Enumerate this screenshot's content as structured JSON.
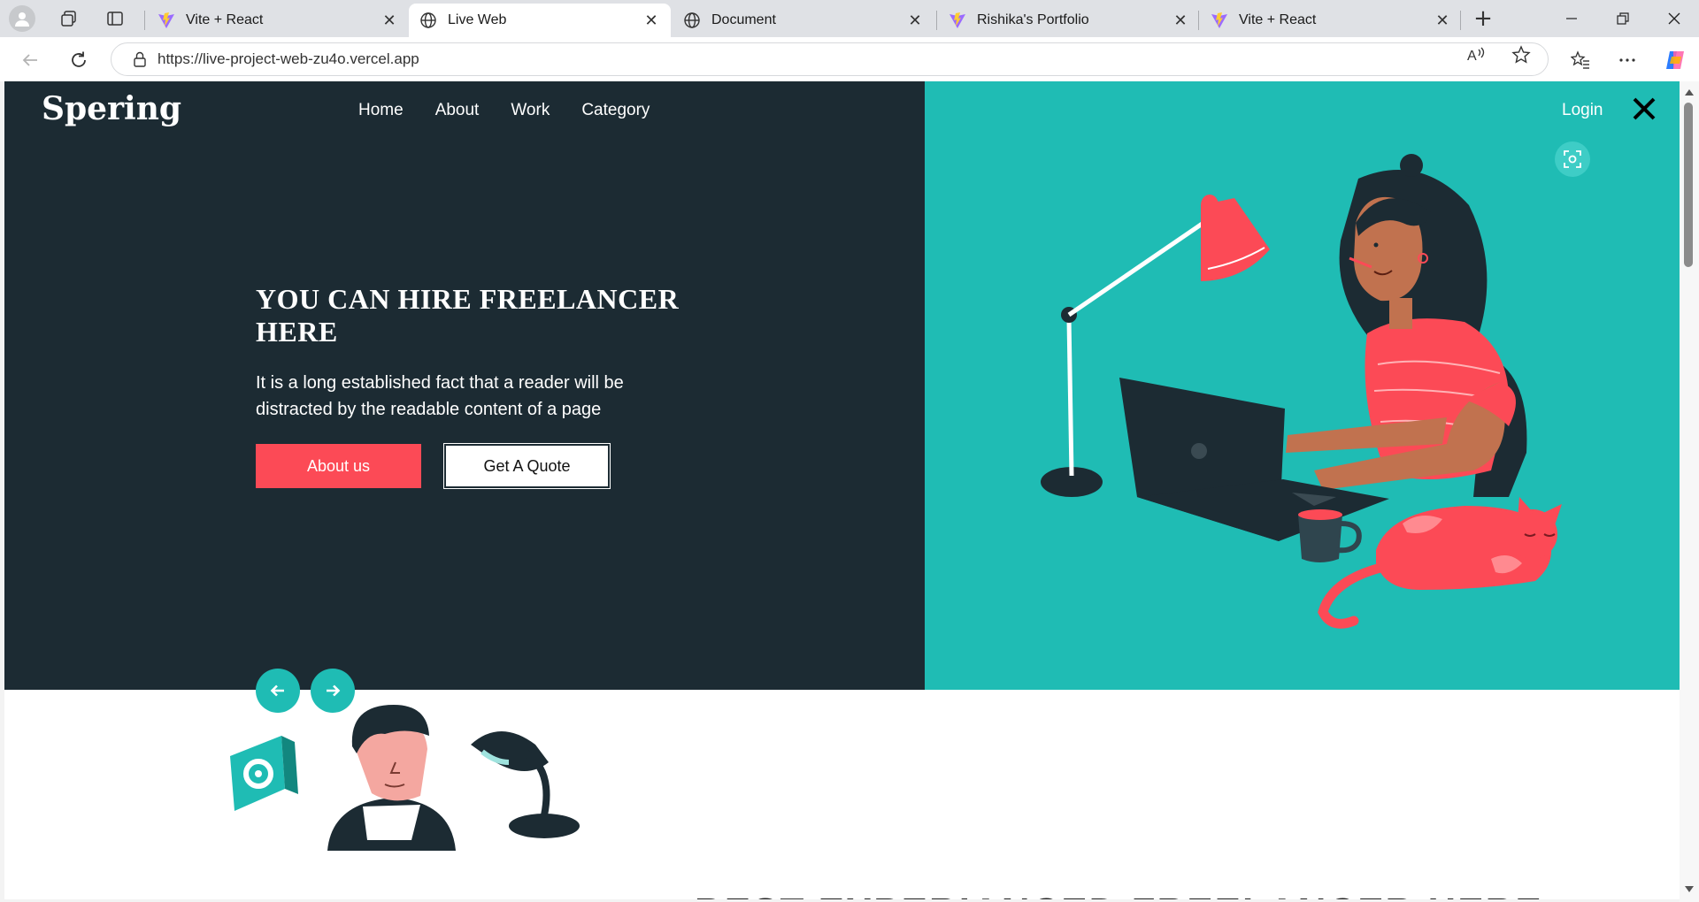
{
  "browser": {
    "tabs": [
      {
        "title": "Vite + React",
        "icon": "vite-icon",
        "active": false
      },
      {
        "title": "Live Web",
        "icon": "globe-icon",
        "active": true
      },
      {
        "title": "Document",
        "icon": "globe-icon",
        "active": false
      },
      {
        "title": "Rishika's Portfolio",
        "icon": "vite-icon",
        "active": false
      },
      {
        "title": "Vite + React",
        "icon": "vite-icon",
        "active": false
      }
    ],
    "tab_close_glyph": "✕",
    "newtab_glyph": "+",
    "url": "https://live-project-web-zu4o.vercel.app"
  },
  "site": {
    "brand": "Spering",
    "nav": [
      "Home",
      "About",
      "Work",
      "Category"
    ],
    "login": "Login",
    "hero": {
      "title": "YOU CAN HIRE FREELANCER HERE",
      "description": "It is a long established fact that a reader will be distracted by the readable content of a page",
      "primary_button": "About us",
      "secondary_button": "Get A Quote"
    },
    "section_heading": "BEST EXPERIANCED FREELANCER HERE"
  },
  "colors": {
    "hero_dark": "#1c2b33",
    "hero_teal": "#1fbcb4",
    "accent_red": "#fc4a56"
  }
}
